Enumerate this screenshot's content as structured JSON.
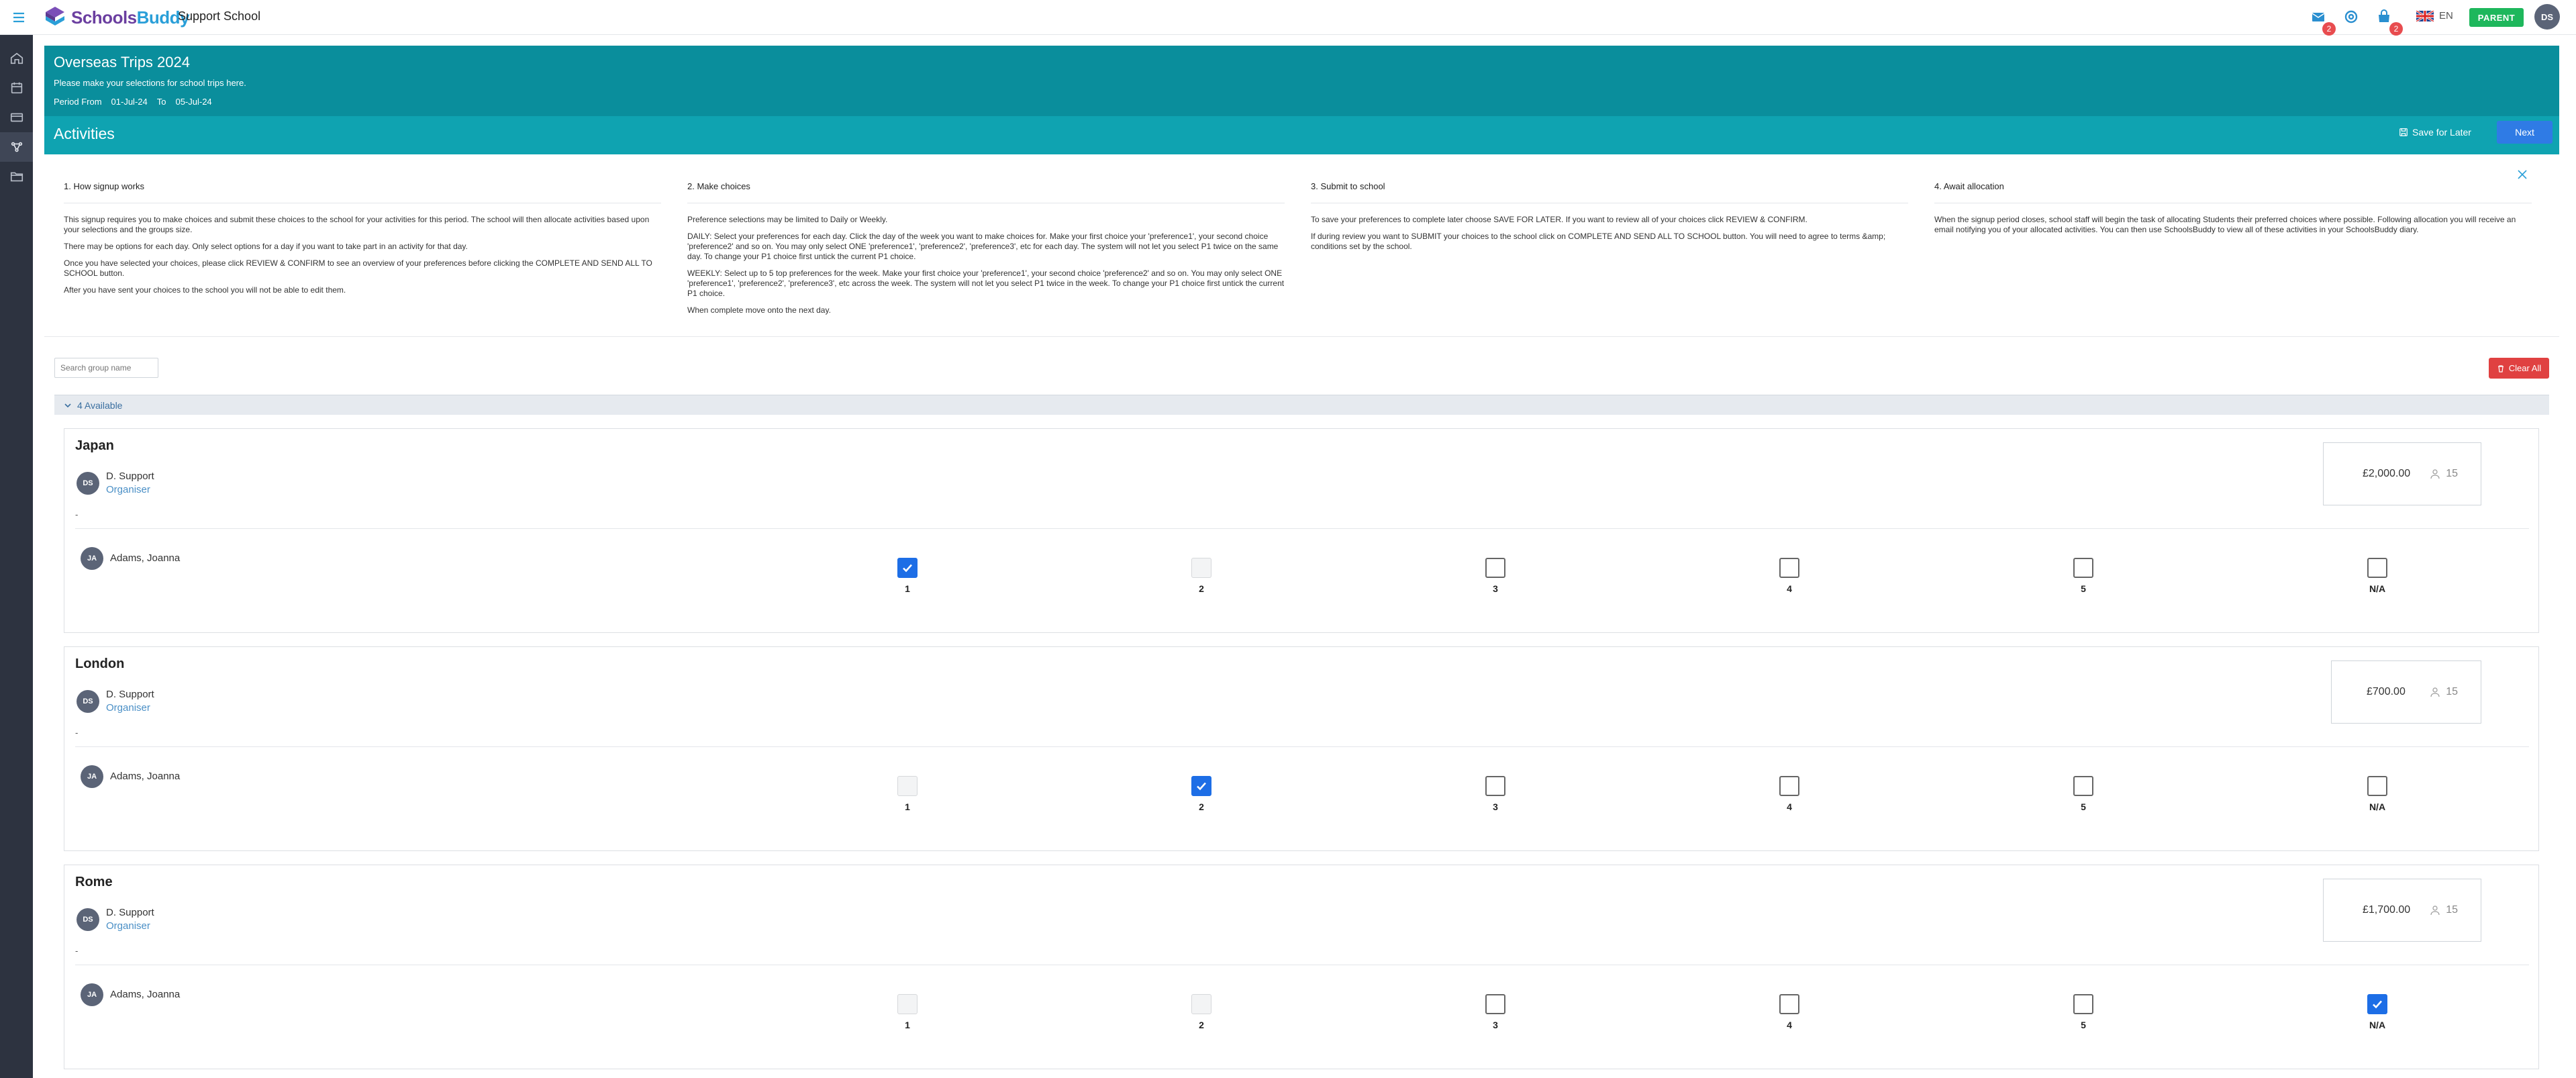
{
  "topbar": {
    "logo": {
      "part1": "Schools",
      "part2": "Buddy"
    },
    "school": "Support School",
    "badges": {
      "messages": "2",
      "store": "2"
    },
    "lang": "EN",
    "role": "PARENT",
    "user_initials": "DS"
  },
  "banner": {
    "title": "Overseas Trips 2024",
    "subtitle": "Please make your selections for school trips here.",
    "period_from_label": "Period From",
    "period_from": "01-Jul-24",
    "period_to_label": "To",
    "period_to": "05-Jul-24",
    "section": "Activities",
    "save_later": "Save for Later",
    "next": "Next"
  },
  "steps": [
    {
      "title": "1. How signup works",
      "paras": [
        "This signup requires you to make choices and submit these choices to the school for your activities for this period. The school will then allocate activities based upon your selections and the groups size.",
        "There may be options for each day. Only select options for a day if you want to take part in an activity for that day.",
        "Once you have selected your choices, please click REVIEW & CONFIRM to see an overview of your preferences before clicking the COMPLETE AND SEND ALL TO SCHOOL button.",
        "After you have sent your choices to the school you will not be able to edit them."
      ]
    },
    {
      "title": "2. Make choices",
      "paras": [
        "Preference selections may be limited to Daily or Weekly.",
        "DAILY: Select your preferences for each day. Click the day of the week you want to make choices for. Make your first choice your 'preference1', your second choice 'preference2' and so on. You may only select ONE 'preference1', 'preference2', 'preference3', etc for each day. The system will not let you select P1 twice on the same day. To change your P1 choice first untick the current P1 choice.",
        "WEEKLY: Select up to 5 top preferences for the week. Make your first choice your 'preference1', your second choice 'preference2' and so on. You may only select ONE 'preference1', 'preference2', 'preference3', etc across the week. The system will not let you select P1 twice in the week. To change your P1 choice first untick the current P1 choice.",
        "When complete move onto the next day."
      ]
    },
    {
      "title": "3. Submit to school",
      "paras": [
        "To save your preferences to complete later choose SAVE FOR LATER. If you want to review all of your choices click REVIEW & CONFIRM.",
        "If during review you want to SUBMIT your choices to the school click on COMPLETE AND SEND ALL TO SCHOOL button. You will need to agree to terms &amp; conditions set by the school."
      ]
    },
    {
      "title": "4. Await allocation",
      "paras": [
        "When the signup period closes, school staff will begin the task of allocating Students their preferred choices where possible. Following allocation you will receive an email notifying you of your allocated activities. You can then use SchoolsBuddy to view all of these activities in your SchoolsBuddy diary."
      ]
    }
  ],
  "search": {
    "placeholder": "Search group name"
  },
  "clear_all": "Clear All",
  "available": "4 Available",
  "activities": [
    {
      "title": "Japan",
      "organiser_initials": "DS",
      "organiser": "D. Support",
      "organiser_role": "Organiser",
      "description": "-",
      "price": "£2,000.00",
      "capacity": "15",
      "student_initials": "JA",
      "student": "Adams, Joanna",
      "choices": [
        {
          "label": "1",
          "state": "checked"
        },
        {
          "label": "2",
          "state": "disabled"
        },
        {
          "label": "3",
          "state": "empty"
        },
        {
          "label": "4",
          "state": "empty"
        },
        {
          "label": "5",
          "state": "empty"
        },
        {
          "label": "N/A",
          "state": "empty"
        }
      ]
    },
    {
      "title": "London",
      "organiser_initials": "DS",
      "organiser": "D. Support",
      "organiser_role": "Organiser",
      "description": "-",
      "price": "£700.00",
      "capacity": "15",
      "student_initials": "JA",
      "student": "Adams, Joanna",
      "choices": [
        {
          "label": "1",
          "state": "disabled"
        },
        {
          "label": "2",
          "state": "checked"
        },
        {
          "label": "3",
          "state": "empty"
        },
        {
          "label": "4",
          "state": "empty"
        },
        {
          "label": "5",
          "state": "empty"
        },
        {
          "label": "N/A",
          "state": "empty"
        }
      ]
    },
    {
      "title": "Rome",
      "organiser_initials": "DS",
      "organiser": "D. Support",
      "organiser_role": "Organiser",
      "description": "-",
      "price": "£1,700.00",
      "capacity": "15",
      "student_initials": "JA",
      "student": "Adams, Joanna",
      "choices": [
        {
          "label": "1",
          "state": "disabled"
        },
        {
          "label": "2",
          "state": "disabled"
        },
        {
          "label": "3",
          "state": "empty"
        },
        {
          "label": "4",
          "state": "empty"
        },
        {
          "label": "5",
          "state": "empty"
        },
        {
          "label": "N/A",
          "state": "checked"
        }
      ]
    }
  ],
  "colors": {
    "teal": "#0fa3b1",
    "teal_dark": "#0a8e9c",
    "accent_blue": "#1d6ee6",
    "parent_green": "#1eb75c",
    "danger": "#e04141"
  }
}
